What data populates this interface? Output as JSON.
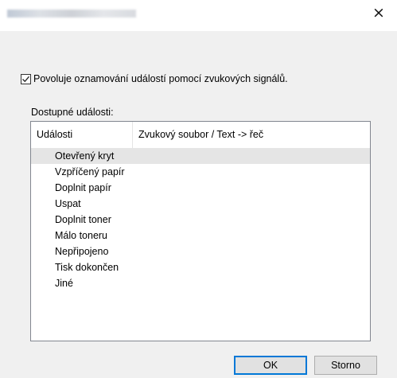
{
  "window": {
    "close_glyph": "×"
  },
  "checkbox": {
    "label": "Povoluje oznamování událostí pomocí zvukových signálů.",
    "checked": true
  },
  "events": {
    "group_label": "Dostupné události:",
    "columns": [
      "Události",
      "Zvukový soubor / Text  -> řeč"
    ],
    "rows": [
      "Otevřený kryt",
      "Vzpříčený papír",
      "Doplnit papír",
      "Uspat",
      "Doplnit toner",
      "Málo toneru",
      "Nepřipojeno",
      "Tisk dokončen",
      "Jiné"
    ]
  },
  "buttons": {
    "ok": "OK",
    "cancel": "Storno"
  },
  "colors": {
    "default_button_border": "#0078d7",
    "selection": "#e5e5e5"
  }
}
